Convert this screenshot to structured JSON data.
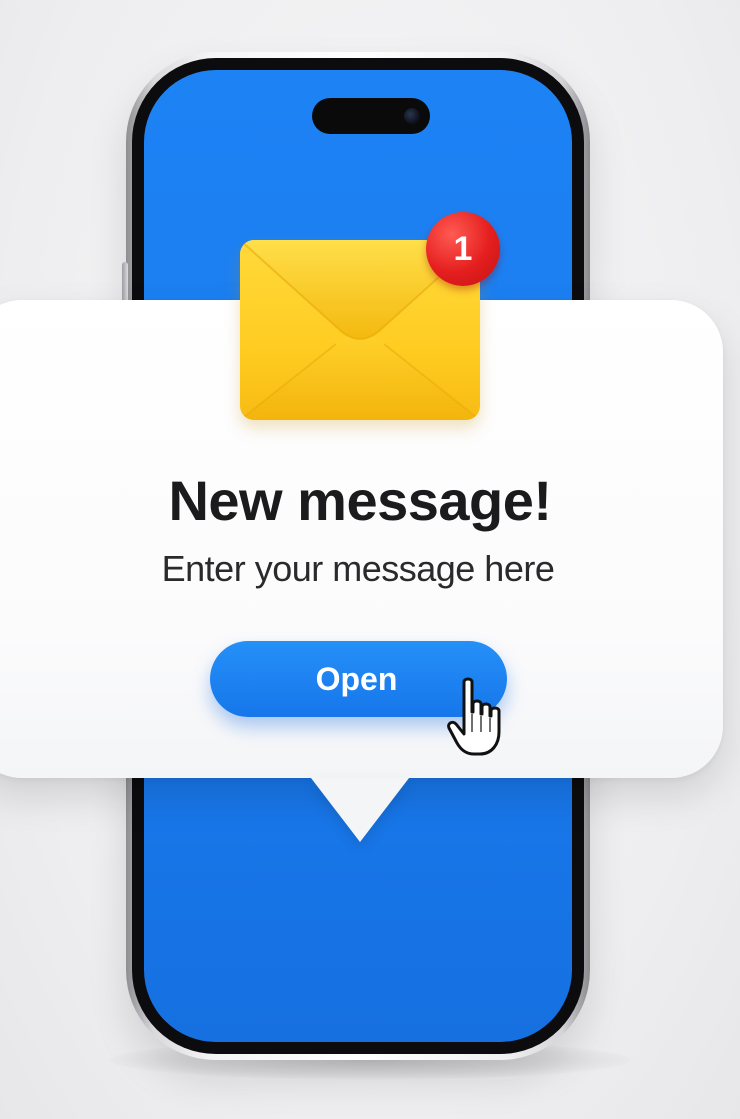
{
  "notification": {
    "badge_count": "1",
    "title": "New message!",
    "subtitle": "Enter your message here",
    "open_button_label": "Open"
  },
  "colors": {
    "screen_blue": "#1a7cf0",
    "button_blue": "#1676ea",
    "envelope_yellow": "#ffcc22",
    "badge_red": "#e41e1e",
    "card_white": "#ffffff"
  },
  "icons": {
    "envelope": "envelope-icon",
    "cursor": "hand-pointer-icon"
  }
}
